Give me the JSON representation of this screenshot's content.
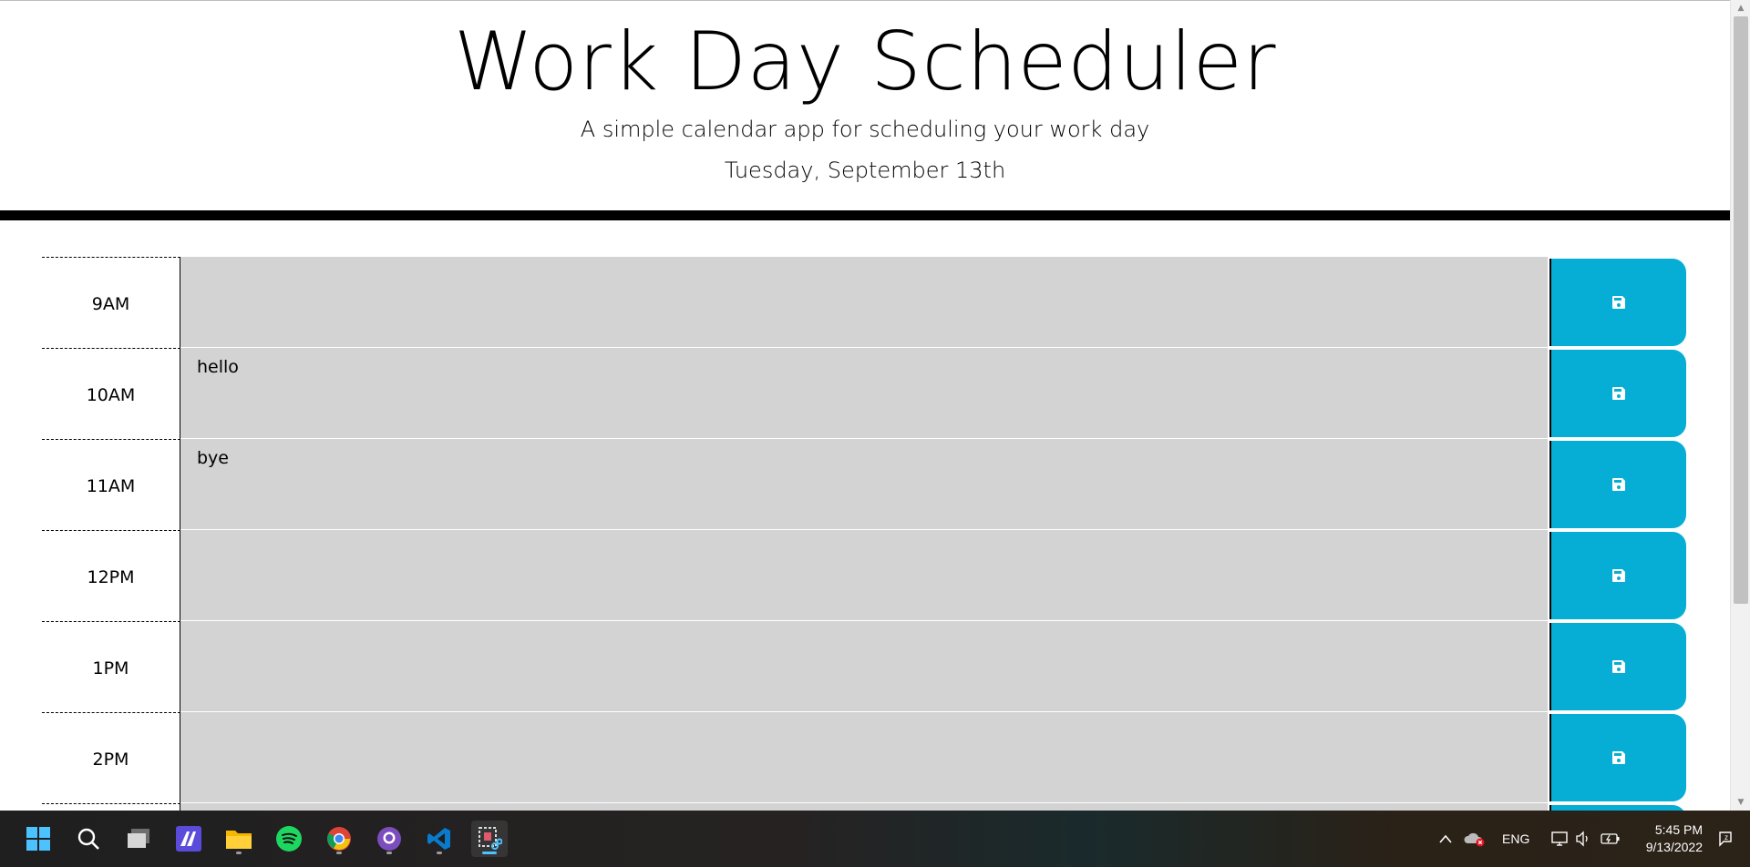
{
  "header": {
    "title": "Work Day Scheduler",
    "subtitle": "A simple calendar app for scheduling your work day",
    "current_day": "Tuesday, September 13th"
  },
  "timeblocks": [
    {
      "hour": "9AM",
      "text": ""
    },
    {
      "hour": "10AM",
      "text": "hello"
    },
    {
      "hour": "11AM",
      "text": "bye"
    },
    {
      "hour": "12PM",
      "text": ""
    },
    {
      "hour": "1PM",
      "text": ""
    },
    {
      "hour": "2PM",
      "text": ""
    }
  ],
  "colors": {
    "block_bg": "#d3d3d3",
    "save_button": "#06aed5",
    "header_border": "#000000"
  },
  "taskbar": {
    "apps": [
      "windows-start-icon",
      "search-icon",
      "task-view-icon",
      "app-icon",
      "file-explorer-icon",
      "spotify-icon",
      "chrome-icon",
      "github-desktop-icon",
      "vscode-icon",
      "snipping-tool-icon"
    ],
    "language": "ENG",
    "time": "5:45 PM",
    "date": "9/13/2022"
  }
}
